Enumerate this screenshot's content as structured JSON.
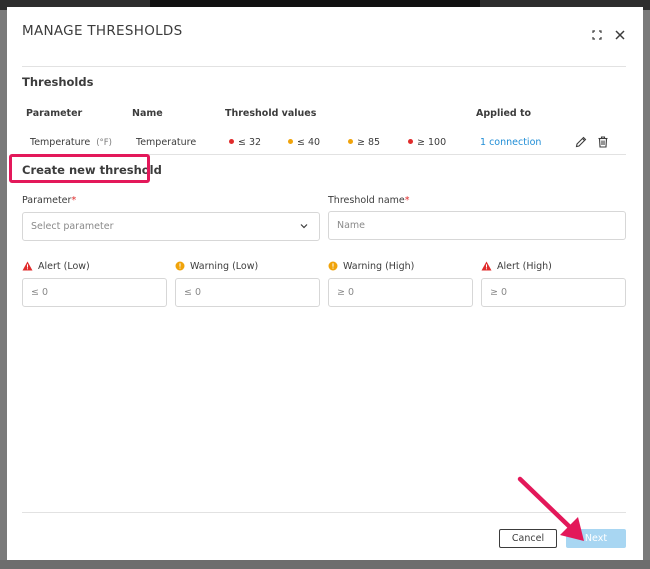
{
  "dialog": {
    "title": "MANAGE THRESHOLDS",
    "expand_icon": "expand-icon",
    "close_icon": "close-icon"
  },
  "thresholds": {
    "section_title": "Thresholds",
    "columns": {
      "parameter": "Parameter",
      "name": "Name",
      "threshold_values": "Threshold values",
      "applied_to": "Applied to"
    },
    "rows": [
      {
        "parameter": "Temperature",
        "unit": "(°F)",
        "name": "Temperature",
        "values": [
          {
            "text": "≤ 32",
            "color": "#e02b2b"
          },
          {
            "text": "≤ 40",
            "color": "#f0a30a"
          },
          {
            "text": "≥ 85",
            "color": "#f0a30a"
          },
          {
            "text": "≥ 100",
            "color": "#e02b2b"
          }
        ],
        "applied_to": "1 connection"
      }
    ]
  },
  "create": {
    "section_title": "Create new threshold",
    "parameter_label": "Parameter",
    "parameter_placeholder": "Select parameter",
    "name_label": "Threshold name",
    "name_placeholder": "Name",
    "required_mark": "*",
    "levels": [
      {
        "label": "Alert (Low)",
        "value": "≤ 0",
        "icon": "alert-triangle-icon",
        "color": "#e02b2b"
      },
      {
        "label": "Warning (Low)",
        "value": "≤ 0",
        "icon": "warning-circle-icon",
        "color": "#f0a30a"
      },
      {
        "label": "Warning (High)",
        "value": "≥ 0",
        "icon": "warning-circle-icon",
        "color": "#f0a30a"
      },
      {
        "label": "Alert (High)",
        "value": "≥ 0",
        "icon": "alert-triangle-icon",
        "color": "#e02b2b"
      }
    ]
  },
  "footer": {
    "cancel_label": "Cancel",
    "next_label": "Next"
  },
  "colors": {
    "highlight": "#e3185a",
    "link": "#1f8dd6",
    "next_disabled": "#a8d6f2"
  }
}
